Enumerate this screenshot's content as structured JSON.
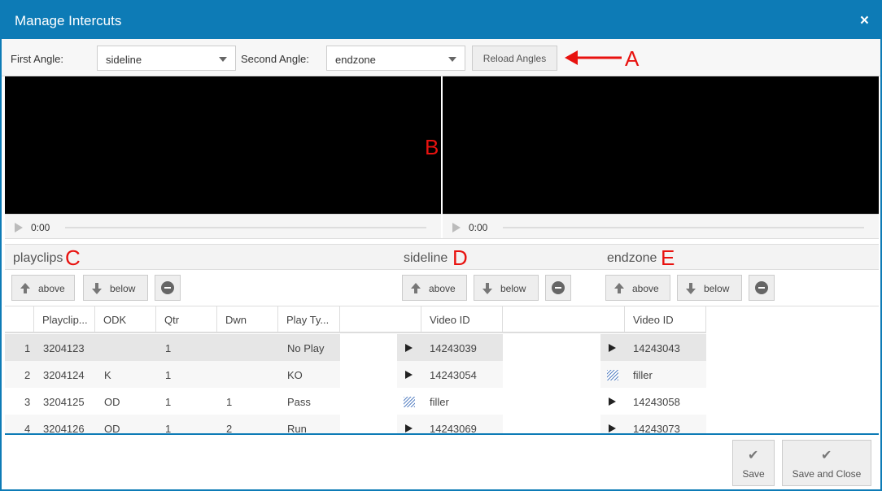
{
  "dialog": {
    "title": "Manage Intercuts",
    "close_icon": "×"
  },
  "angles": {
    "first_label": "First Angle:",
    "first_value": "sideline",
    "second_label": "Second Angle:",
    "second_value": "endzone",
    "reload_label": "Reload Angles"
  },
  "annotations": {
    "a": "A",
    "b": "B",
    "c": "C",
    "d": "D",
    "e": "E"
  },
  "players": [
    {
      "time": "0:00"
    },
    {
      "time": "0:00"
    }
  ],
  "sections": {
    "playclips": "playclips",
    "sideline": "sideline",
    "endzone": "endzone"
  },
  "toolbar": {
    "above": "above",
    "below": "below"
  },
  "playclips": {
    "headers": [
      "Playclip...",
      "ODK",
      "Qtr",
      "Dwn",
      "Play Ty..."
    ],
    "rows": [
      {
        "n": "1",
        "id": "3204123",
        "odk": "",
        "qtr": "1",
        "dwn": "",
        "type": "No Play"
      },
      {
        "n": "2",
        "id": "3204124",
        "odk": "K",
        "qtr": "1",
        "dwn": "",
        "type": "KO"
      },
      {
        "n": "3",
        "id": "3204125",
        "odk": "OD",
        "qtr": "1",
        "dwn": "1",
        "type": "Pass"
      },
      {
        "n": "4",
        "id": "3204126",
        "odk": "OD",
        "qtr": "1",
        "dwn": "2",
        "type": "Run"
      }
    ]
  },
  "sideline": {
    "header": "Video ID",
    "rows": [
      {
        "kind": "play",
        "id": "14243039"
      },
      {
        "kind": "play",
        "id": "14243054"
      },
      {
        "kind": "filler",
        "id": "filler"
      },
      {
        "kind": "play",
        "id": "14243069"
      }
    ]
  },
  "endzone": {
    "header": "Video ID",
    "rows": [
      {
        "kind": "play",
        "id": "14243043"
      },
      {
        "kind": "filler",
        "id": "filler"
      },
      {
        "kind": "play",
        "id": "14243058"
      },
      {
        "kind": "play",
        "id": "14243073"
      }
    ]
  },
  "footer": {
    "save": "Save",
    "save_close": "Save and Close",
    "check_icon": "✔"
  },
  "colors": {
    "accent": "#0d7bb6",
    "annotation": "#e8120f",
    "video_bg": "#000000"
  }
}
